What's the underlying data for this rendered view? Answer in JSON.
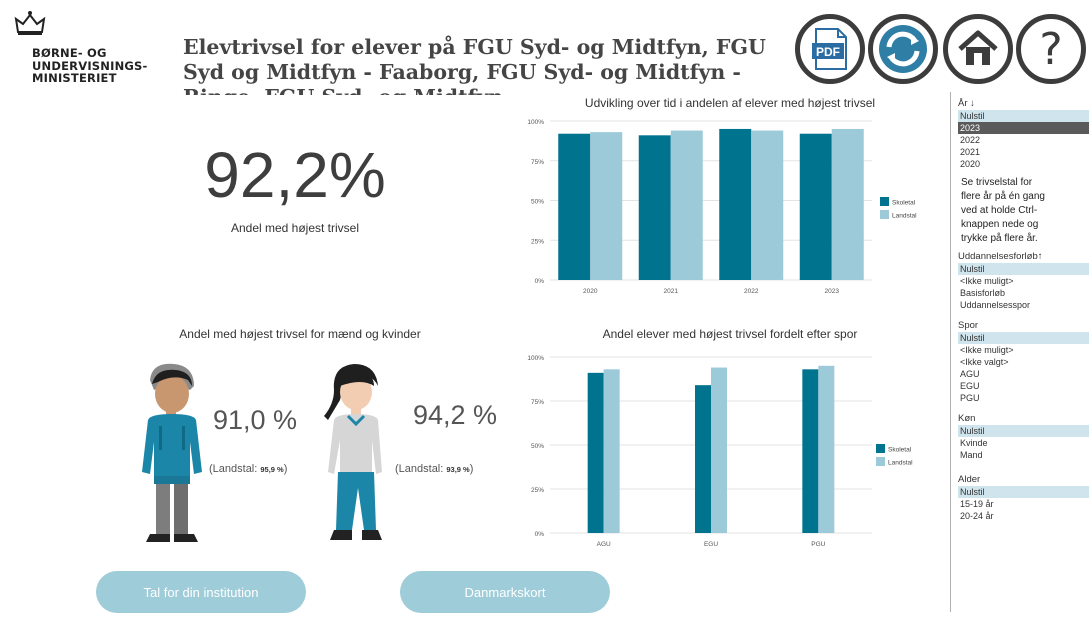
{
  "header": {
    "ministry_line1": "BØRNE- OG",
    "ministry_line2": "UNDERVISNINGS-",
    "ministry_line3": "MINISTERIET",
    "title_line1": "Elevtrivsel for elever på FGU Syd- og Midtfyn, FGU",
    "title_line2": "Syd og Midtfyn - Faaborg, FGU Syd- og Midtfyn -",
    "title_line3": "Ringe, FGU Syd- og Midtfyn -",
    "pdf_label": "PDF",
    "help_label": "?"
  },
  "kpi": {
    "value": "92,2%",
    "label": "Andel med højest trivsel"
  },
  "gender": {
    "title": "Andel med højest trivsel for mænd og kvinder",
    "male_value": "91,0 %",
    "male_landstal_label": "(Landstal:",
    "male_landstal_value": "95,9 %",
    "female_value": "94,2 %",
    "female_landstal_label": "(Landstal:",
    "female_landstal_value": "93,9 %",
    "close_paren": ")"
  },
  "colors": {
    "skoletal": "#00748e",
    "landstal": "#9ccad8",
    "button": "#9fccd9"
  },
  "chart_data": [
    {
      "type": "bar",
      "title": "Udvikling over tid i andelen af elever med højest trivsel",
      "categories": [
        "2020",
        "2021",
        "2022",
        "2023"
      ],
      "series": [
        {
          "name": "Skoletal",
          "values": [
            92,
            91,
            95,
            92
          ]
        },
        {
          "name": "Landstal",
          "values": [
            93,
            94,
            94,
            95
          ]
        }
      ],
      "ylim": [
        0,
        100
      ],
      "yticks": [
        "0%",
        "25%",
        "50%",
        "75%",
        "100%"
      ],
      "grid": true,
      "legend": "right"
    },
    {
      "type": "bar",
      "title": "Andel elever med højest trivsel fordelt efter spor",
      "categories": [
        "AGU",
        "EGU",
        "PGU"
      ],
      "series": [
        {
          "name": "Skoletal",
          "values": [
            91,
            84,
            93
          ]
        },
        {
          "name": "Landstal",
          "values": [
            93,
            94,
            95
          ]
        }
      ],
      "ylim": [
        0,
        100
      ],
      "yticks": [
        "0%",
        "25%",
        "50%",
        "75%",
        "100%"
      ],
      "grid": true,
      "legend": "right"
    }
  ],
  "buttons": {
    "institution": "Tal for din institution",
    "map": "Danmarkskort"
  },
  "slicers": {
    "year_head": "År",
    "year_items": [
      "Nulstil",
      "2023",
      "2022",
      "2021",
      "2020"
    ],
    "note": [
      "Se trivselstal for",
      "flere år på én gang",
      "ved at holde Ctrl-",
      "knappen nede og",
      "trykke på flere år."
    ],
    "course_head": "Uddannelsesforløb",
    "course_items": [
      "Nulstil",
      "<Ikke muligt>",
      "Basisforløb",
      "Uddannelsesspor"
    ],
    "track_head": "Spor",
    "track_items": [
      "Nulstil",
      "<Ikke muligt>",
      "<Ikke valgt>",
      "AGU",
      "EGU",
      "PGU"
    ],
    "gender_head": "Køn",
    "gender_items": [
      "Nulstil",
      "Kvinde",
      "Mand"
    ],
    "age_head": "Alder",
    "age_items": [
      "Nulstil",
      "15-19 år",
      "20-24 år"
    ]
  }
}
